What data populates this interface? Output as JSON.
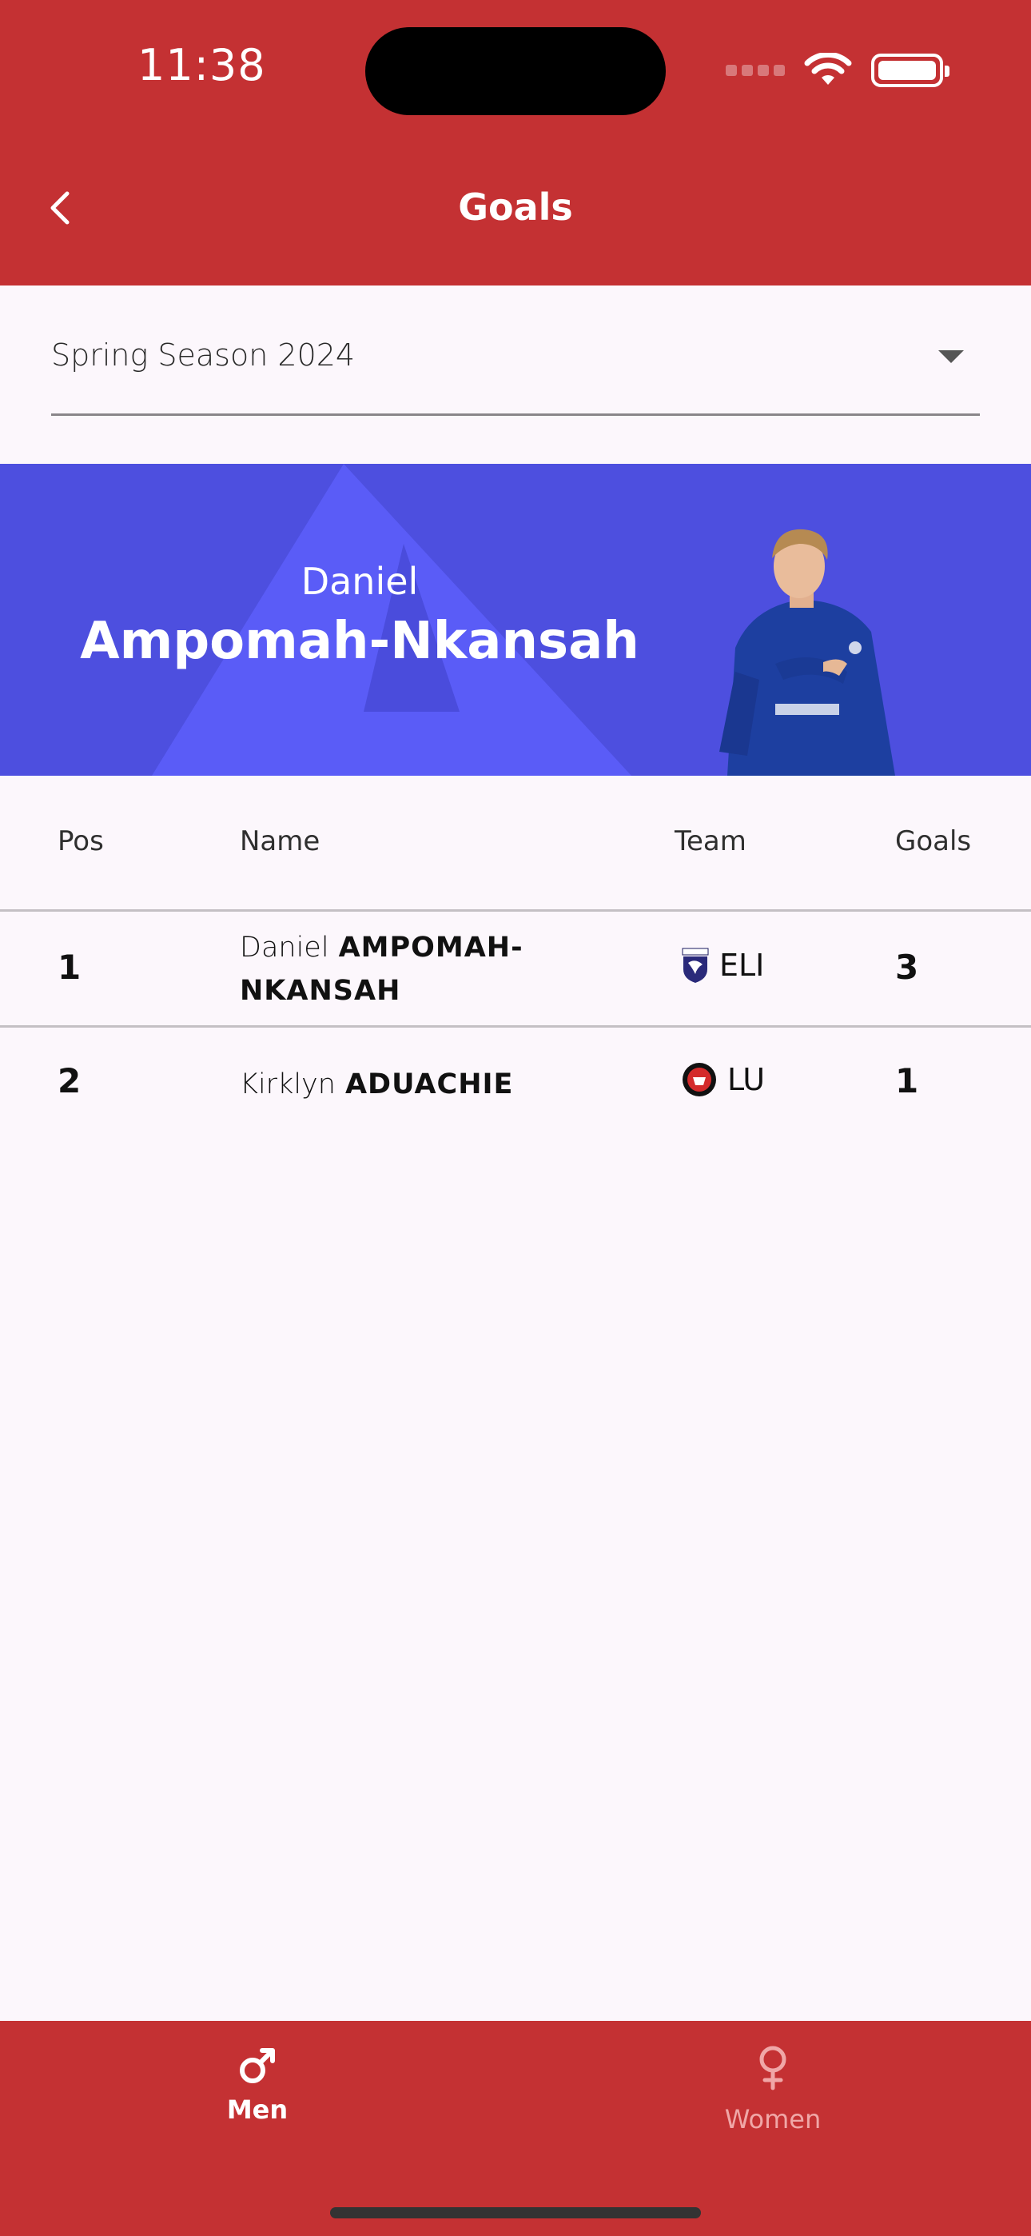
{
  "status_bar": {
    "time": "11:38"
  },
  "header": {
    "title": "Goals"
  },
  "season_select": {
    "value": "Spring Season 2024"
  },
  "top_scorer": {
    "first_name": "Daniel",
    "last_name": "Ampomah-Nkansah"
  },
  "table": {
    "columns": [
      "Pos",
      "Name",
      "Team",
      "Goals"
    ],
    "rows": [
      {
        "pos": "1",
        "first": "Daniel",
        "last": "AMPOMAH-NKANSAH",
        "team": "ELI",
        "goals": "3"
      },
      {
        "pos": "2",
        "first": "Kirklyn",
        "last": "ADUACHIE",
        "team": "LU",
        "goals": "1"
      }
    ]
  },
  "bottom_nav": {
    "items": [
      {
        "label": "Men",
        "icon": "male-icon",
        "active": true
      },
      {
        "label": "Women",
        "icon": "female-icon",
        "active": false
      }
    ]
  },
  "colors": {
    "primary": "#c43133",
    "banner": "#4d4fdf"
  }
}
